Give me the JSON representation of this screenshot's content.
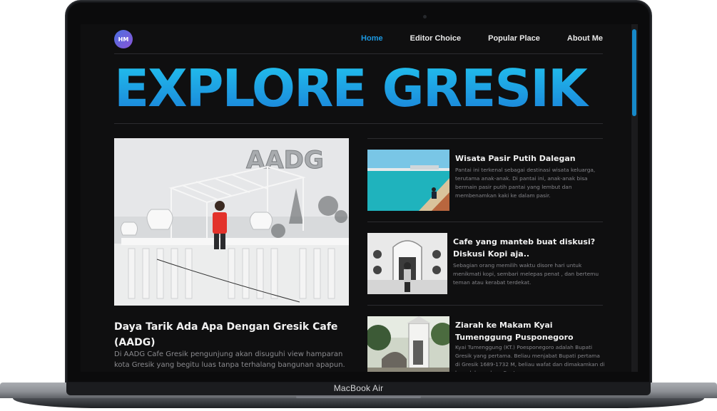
{
  "device": {
    "label": "MacBook Air"
  },
  "site": {
    "logo_text": "HM",
    "nav": [
      {
        "label": "Home",
        "active": true
      },
      {
        "label": "Editor Choice",
        "active": false
      },
      {
        "label": "Popular Place",
        "active": false
      },
      {
        "label": "About Me",
        "active": false
      }
    ],
    "hero_title": "EXPLORE GRESIK",
    "featured": {
      "image_text": "AADG",
      "title": "Daya Tarik Ada Apa Dengan Gresik Cafe (AADG)",
      "text": "Di AADG Cafe Gresik pengunjung akan disuguhi view hamparan kota Gresik yang begitu luas tanpa terhalang bangunan apapun."
    },
    "cards": [
      {
        "title": "Wisata Pasir Putih Dalegan",
        "text": "Pantai ini terkenal sebagai destinasi wisata keluarga, terutama anak-anak. Di pantai ini, anak-anak bisa bermain pasir putih pantai yang lembut dan membenamkan kaki ke dalam pasir."
      },
      {
        "title": "Cafe yang manteb buat diskusi? Diskusi Kopi aja..",
        "text": "Sebagian orang memilih waktu disore hari untuk menikmati kopi, sembari melepas penat , dan bertemu teman atau kerabat terdekat."
      },
      {
        "title": "Ziarah ke Makam Kyai Tumenggung Pusponegoro",
        "text": "Kyai Tumenggung (KT.) Poesponegoro adalah Bupati Gresik yang pertama. Beliau menjabat Bupati pertama di Gresik 1689-1732 M, beliau wafat dan dimakamkan di kompleks makam Sentono."
      }
    ]
  },
  "colors": {
    "accent": "#1c98e0",
    "hero_top": "#22c3ee",
    "hero_bottom": "#1a80d8",
    "background": "#0f0f10"
  }
}
